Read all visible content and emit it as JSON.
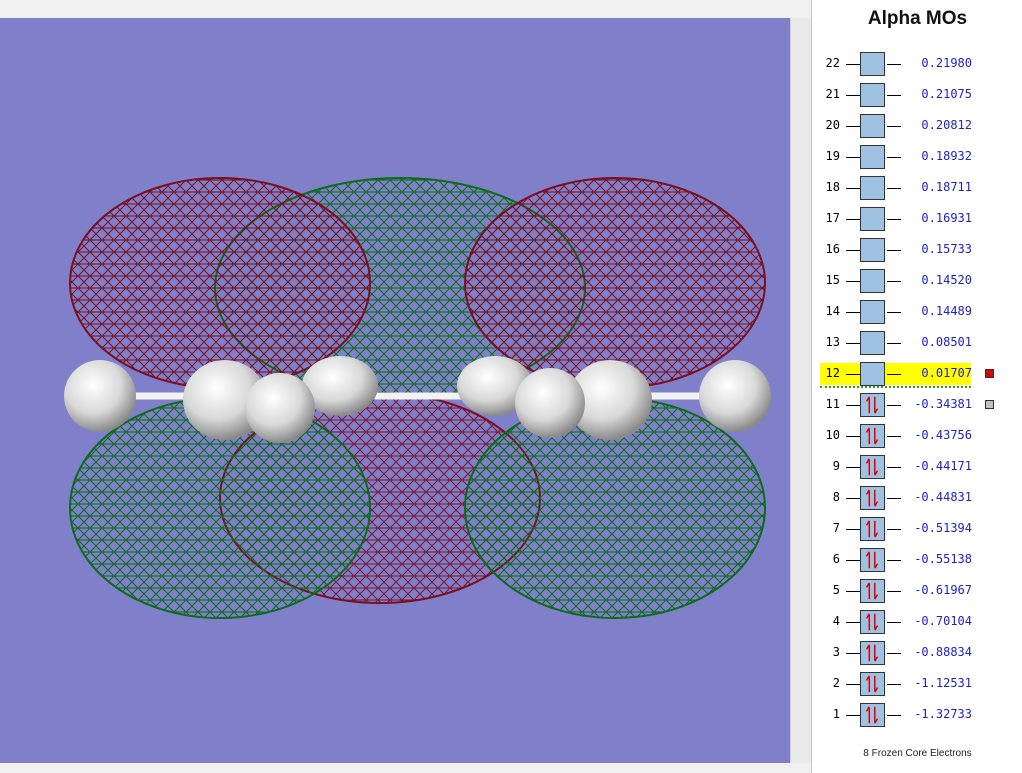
{
  "panel": {
    "title": "Alpha MOs",
    "frozen_note": "8 Frozen Core Electrons",
    "orbitals": [
      {
        "n": "22",
        "energy": "0.21980",
        "occupied": false
      },
      {
        "n": "21",
        "energy": "0.21075",
        "occupied": false
      },
      {
        "n": "20",
        "energy": "0.20812",
        "occupied": false
      },
      {
        "n": "19",
        "energy": "0.18932",
        "occupied": false
      },
      {
        "n": "18",
        "energy": "0.18711",
        "occupied": false
      },
      {
        "n": "17",
        "energy": "0.16931",
        "occupied": false
      },
      {
        "n": "16",
        "energy": "0.15733",
        "occupied": false
      },
      {
        "n": "15",
        "energy": "0.14520",
        "occupied": false
      },
      {
        "n": "14",
        "energy": "0.14489",
        "occupied": false
      },
      {
        "n": "13",
        "energy": "0.08501",
        "occupied": false
      },
      {
        "n": "12",
        "energy": "0.01707",
        "occupied": false,
        "selected": true,
        "swatch": "#dd0000"
      },
      {
        "n": "11",
        "energy": "-0.34381",
        "occupied": true,
        "swatch": "#c0c0c0"
      },
      {
        "n": "10",
        "energy": "-0.43756",
        "occupied": true
      },
      {
        "n": "9",
        "energy": "-0.44171",
        "occupied": true
      },
      {
        "n": "8",
        "energy": "-0.44831",
        "occupied": true
      },
      {
        "n": "7",
        "energy": "-0.51394",
        "occupied": true
      },
      {
        "n": "6",
        "energy": "-0.55138",
        "occupied": true
      },
      {
        "n": "5",
        "energy": "-0.61967",
        "occupied": true
      },
      {
        "n": "4",
        "energy": "-0.70104",
        "occupied": true
      },
      {
        "n": "3",
        "energy": "-0.88834",
        "occupied": true
      },
      {
        "n": "2",
        "energy": "-1.12531",
        "occupied": true
      },
      {
        "n": "1",
        "energy": "-1.32733",
        "occupied": true
      }
    ]
  },
  "viewer": {
    "background": "#7f7fca",
    "positive_lobe_color": "#7a1020",
    "negative_lobe_color": "#0d6b1a",
    "atom_color": "#e8e8e8"
  }
}
